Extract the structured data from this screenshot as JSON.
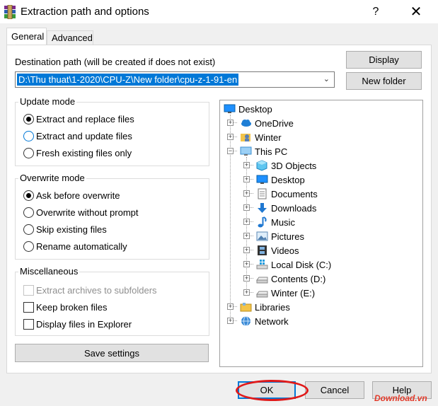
{
  "window": {
    "title": "Extraction path and options",
    "help_label": "?",
    "close_label": "✕"
  },
  "tabs": [
    {
      "label": "General",
      "active": true
    },
    {
      "label": "Advanced",
      "active": false
    }
  ],
  "destination": {
    "label": "Destination path (will be created if does not exist)",
    "value": "D:\\Thu thuat\\1-2020\\CPU-Z\\New folder\\cpu-z-1-91-en"
  },
  "side_buttons": {
    "display": "Display",
    "new_folder": "New folder"
  },
  "update_mode": {
    "title": "Update mode",
    "options": [
      {
        "label": "Extract and replace files",
        "selected": true
      },
      {
        "label": "Extract and update files",
        "selected": false
      },
      {
        "label": "Fresh existing files only",
        "selected": false
      }
    ]
  },
  "overwrite_mode": {
    "title": "Overwrite mode",
    "options": [
      {
        "label": "Ask before overwrite",
        "selected": true
      },
      {
        "label": "Overwrite without prompt",
        "selected": false
      },
      {
        "label": "Skip existing files",
        "selected": false
      },
      {
        "label": "Rename automatically",
        "selected": false
      }
    ]
  },
  "misc": {
    "title": "Miscellaneous",
    "options": [
      {
        "label": "Extract archives to subfolders",
        "checked": false,
        "disabled": true
      },
      {
        "label": "Keep broken files",
        "checked": false,
        "disabled": false
      },
      {
        "label": "Display files in Explorer",
        "checked": false,
        "disabled": false
      }
    ]
  },
  "save_settings": "Save settings",
  "tree": {
    "root": {
      "label": "Desktop",
      "icon": "desktop-icon"
    },
    "items": [
      {
        "label": "OneDrive",
        "icon": "cloud-icon",
        "level": 1
      },
      {
        "label": "Winter",
        "icon": "user-folder-icon",
        "level": 1
      },
      {
        "label": "This PC",
        "icon": "computer-icon",
        "level": 1,
        "expanded": true
      },
      {
        "label": "3D Objects",
        "icon": "cube-icon",
        "level": 2
      },
      {
        "label": "Desktop",
        "icon": "desktop-icon",
        "level": 2
      },
      {
        "label": "Documents",
        "icon": "document-icon",
        "level": 2
      },
      {
        "label": "Downloads",
        "icon": "download-arrow-icon",
        "level": 2
      },
      {
        "label": "Music",
        "icon": "music-note-icon",
        "level": 2
      },
      {
        "label": "Pictures",
        "icon": "picture-icon",
        "level": 2
      },
      {
        "label": "Videos",
        "icon": "film-icon",
        "level": 2
      },
      {
        "label": "Local Disk (C:)",
        "icon": "windows-drive-icon",
        "level": 2
      },
      {
        "label": "Contents (D:)",
        "icon": "drive-icon",
        "level": 2
      },
      {
        "label": "Winter (E:)",
        "icon": "drive-icon",
        "level": 2
      },
      {
        "label": "Libraries",
        "icon": "library-icon",
        "level": 1
      },
      {
        "label": "Network",
        "icon": "network-icon",
        "level": 1
      }
    ]
  },
  "footer": {
    "ok": "OK",
    "cancel": "Cancel",
    "help": "Help"
  },
  "watermark": "Download.vn",
  "colors": {
    "accent": "#0078d7",
    "annotation": "#e01919"
  }
}
